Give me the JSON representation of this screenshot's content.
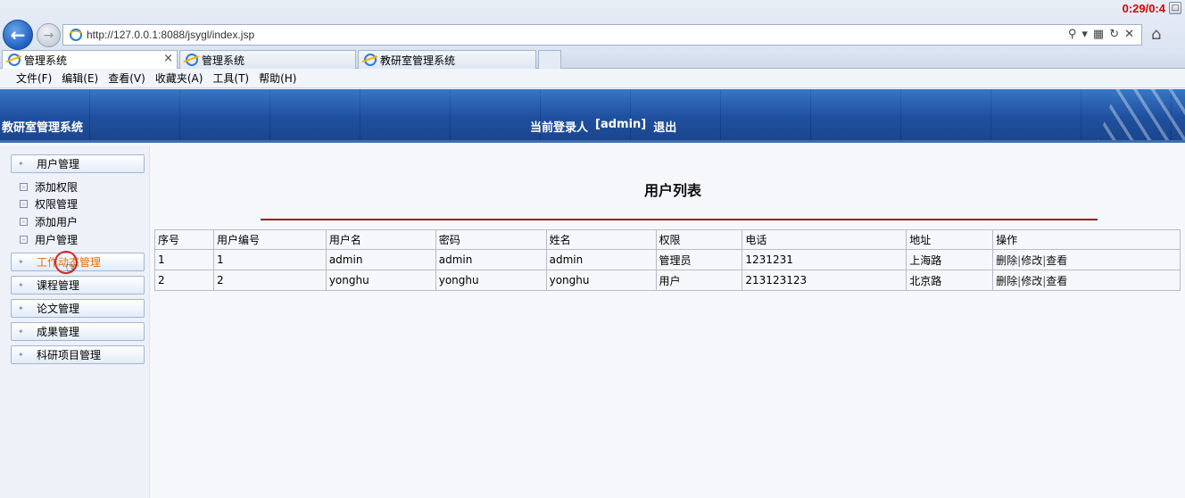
{
  "browser": {
    "url": "http://127.0.0.1:8088/jsygl/index.jsp",
    "clock": "0:29/0:4",
    "tabs": [
      {
        "label": "管理系统",
        "active": true,
        "close": "×"
      },
      {
        "label": "管理系统",
        "active": false
      },
      {
        "label": "教研室管理系统",
        "active": false
      }
    ],
    "menu": [
      "文件(F)",
      "编辑(E)",
      "查看(V)",
      "收藏夹(A)",
      "工具(T)",
      "帮助(H)"
    ]
  },
  "header": {
    "app_title": "教研室管理系统",
    "login_label": "当前登录人",
    "login_user": "[admin]",
    "logout": "退出"
  },
  "sidebar": {
    "groups": [
      {
        "label": "用户管理",
        "subitems": [
          "添加权限",
          "权限管理",
          "添加用户",
          "用户管理"
        ]
      },
      {
        "label": "工作动态管理"
      },
      {
        "label": "课程管理"
      },
      {
        "label": "论文管理"
      },
      {
        "label": "成果管理"
      },
      {
        "label": "科研项目管理"
      }
    ]
  },
  "main": {
    "title": "用户列表",
    "table": {
      "headers": [
        "序号",
        "用户编号",
        "用户名",
        "密码",
        "姓名",
        "权限",
        "电话",
        "地址",
        "操作"
      ],
      "rows": [
        {
          "no": "1",
          "code": "1",
          "username": "admin",
          "password": "admin",
          "name": "admin",
          "role": "管理员",
          "phone": "1231231",
          "address": "上海路"
        },
        {
          "no": "2",
          "code": "2",
          "username": "yonghu",
          "password": "yonghu",
          "name": "yonghu",
          "role": "用户",
          "phone": "213123123",
          "address": "北京路"
        }
      ],
      "ops": {
        "delete": "删除",
        "edit": "修改",
        "view": "查看",
        "sep": "|"
      }
    }
  },
  "colors": {
    "header_blue": "#13479a",
    "rule_red": "#9b1f1f",
    "hover_orange": "#e0700c"
  }
}
